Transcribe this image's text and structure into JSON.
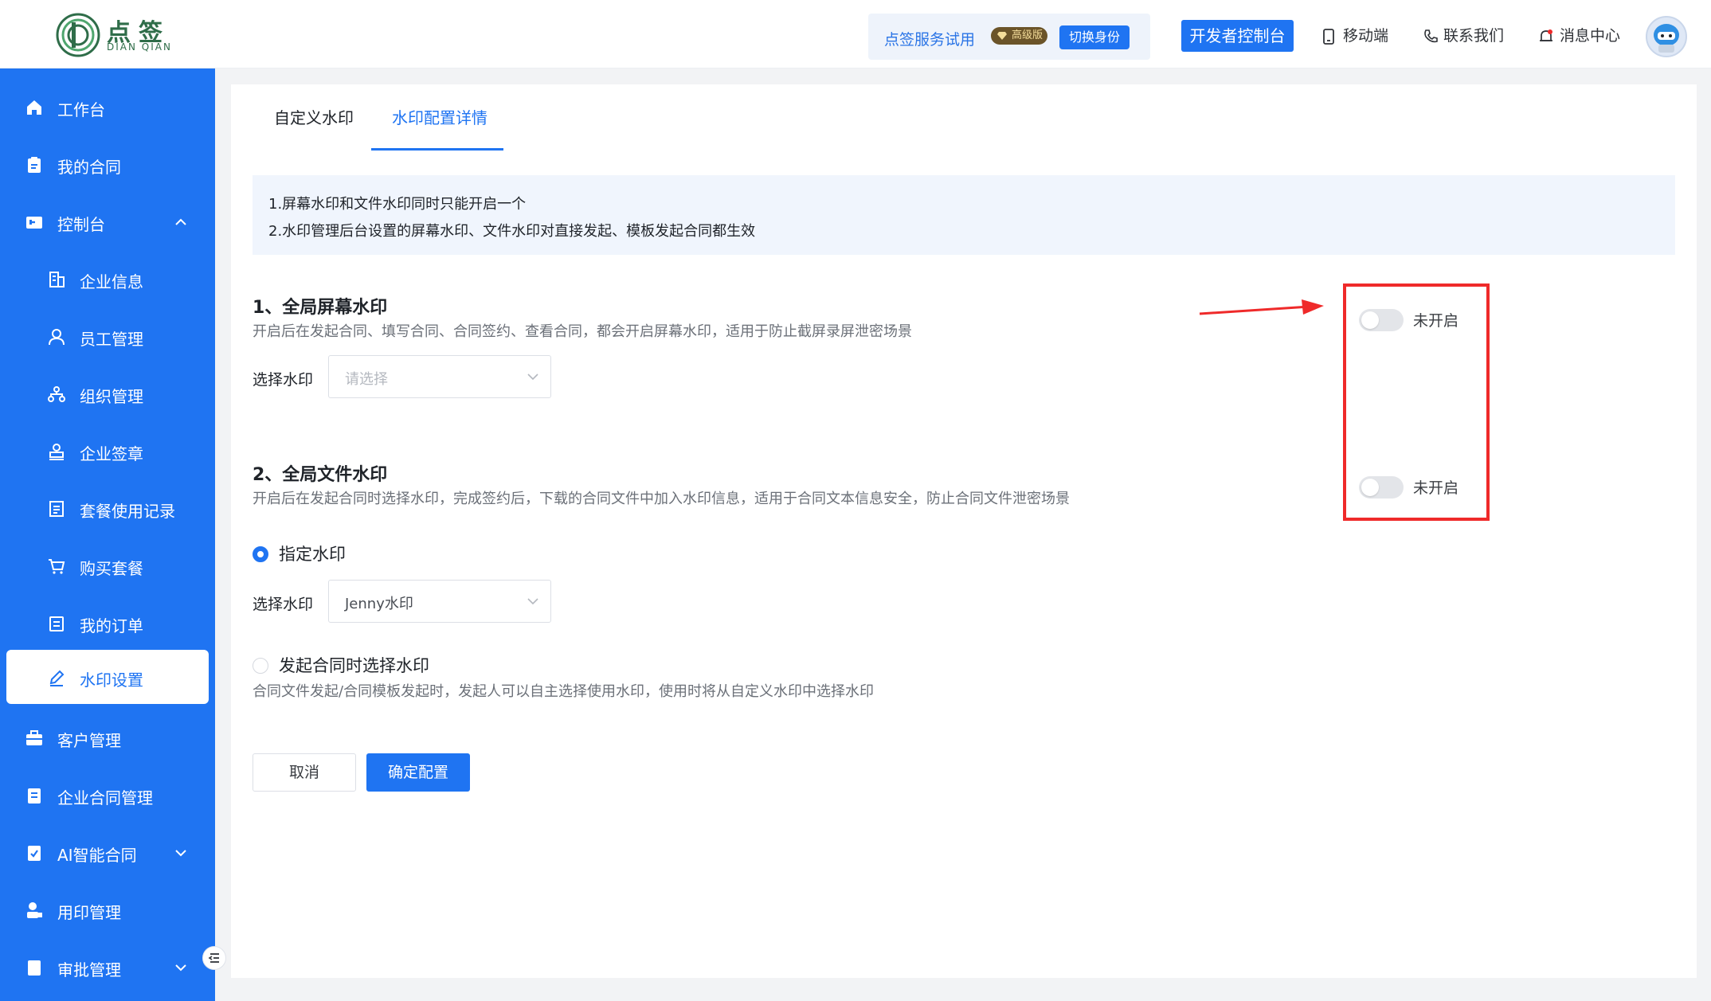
{
  "header": {
    "logo": {
      "cn": "点签",
      "en": "DIAN QIAN"
    },
    "trial": {
      "text": "点签服务试用",
      "badge": "高级版",
      "switch_label": "切换身份"
    },
    "dev_console": "开发者控制台",
    "links": {
      "mobile": "移动端",
      "contact": "联系我们",
      "messages": "消息中心"
    }
  },
  "sidebar": {
    "items": [
      {
        "label": "工作台"
      },
      {
        "label": "我的合同"
      },
      {
        "label": "控制台"
      },
      {
        "label": "企业信息"
      },
      {
        "label": "员工管理"
      },
      {
        "label": "组织管理"
      },
      {
        "label": "企业签章"
      },
      {
        "label": "套餐使用记录"
      },
      {
        "label": "购买套餐"
      },
      {
        "label": "我的订单"
      },
      {
        "label": "水印设置"
      },
      {
        "label": "客户管理"
      },
      {
        "label": "企业合同管理"
      },
      {
        "label": "AI智能合同"
      },
      {
        "label": "用印管理"
      },
      {
        "label": "审批管理"
      }
    ]
  },
  "tabs": [
    {
      "label": "自定义水印"
    },
    {
      "label": "水印配置详情"
    }
  ],
  "notice": {
    "line1": "1.屏幕水印和文件水印同时只能开启一个",
    "line2": "2.水印管理后台设置的屏幕水印、文件水印对直接发起、模板发起合同都生效"
  },
  "screen_watermark": {
    "title": "1、全局屏幕水印",
    "desc": "开启后在发起合同、填写合同、合同签约、查看合同，都会开启屏幕水印，适用于防止截屏录屏泄密场景",
    "select_label": "选择水印",
    "select_placeholder": "请选择",
    "toggle_state": "未开启"
  },
  "file_watermark": {
    "title": "2、全局文件水印",
    "desc": "开启后在发起合同时选择水印，完成签约后，下载的合同文件中加入水印信息，适用于合同文本信息安全，防止合同文件泄密场景",
    "toggle_state": "未开启",
    "option_specify": "指定水印",
    "select_label": "选择水印",
    "select_value": "Jenny水印",
    "option_choose": "发起合同时选择水印",
    "option_choose_desc": "合同文件发起/合同模板发起时，发起人可以自主选择使用水印，使用时将从自定义水印中选择水印"
  },
  "actions": {
    "cancel": "取消",
    "confirm": "确定配置"
  },
  "colors": {
    "primary": "#1f74f2",
    "annotation": "#ef2a2a",
    "logo_green": "#2f6d49"
  }
}
